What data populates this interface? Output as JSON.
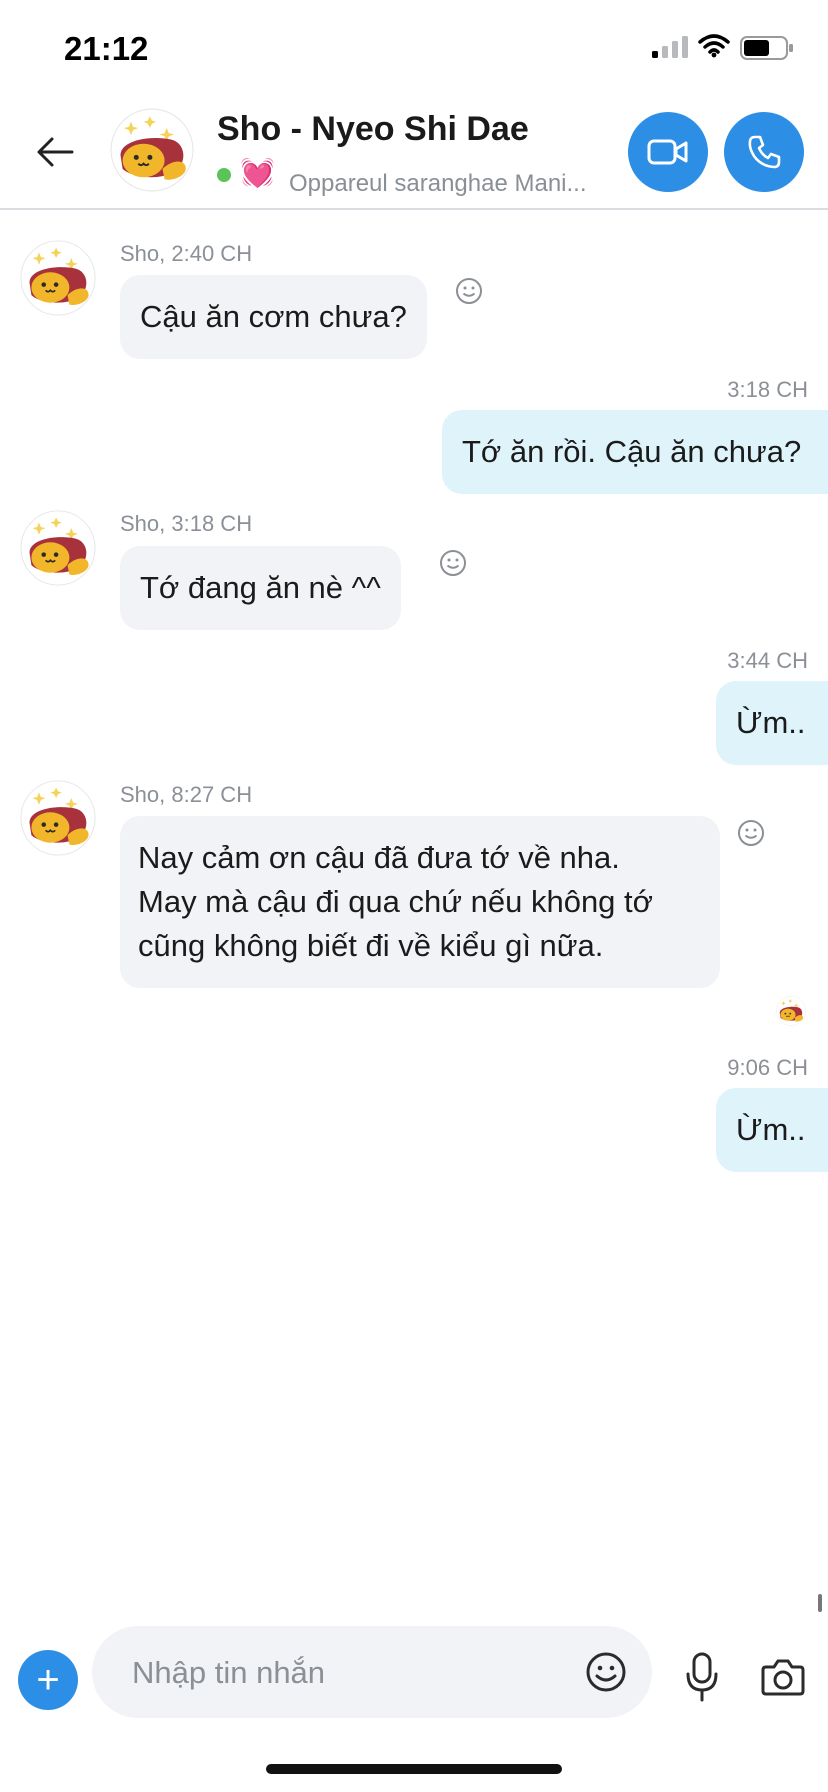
{
  "status_bar": {
    "time": "21:12"
  },
  "header": {
    "contact_name": "Sho - Nyeo Shi Dae",
    "status_text": "Oppareul saranghae Mani...",
    "heart_glyph": "💓",
    "online_color": "#5ac35a",
    "accent_color": "#2d8ee6"
  },
  "messages": [
    {
      "direction": "in",
      "meta": "Sho, 2:40 CH",
      "text": "Cậu ăn cơm chưa?"
    },
    {
      "direction": "out",
      "meta": "3:18 CH",
      "text": "Tớ ăn rồi. Cậu ăn chưa?"
    },
    {
      "direction": "in",
      "meta": "Sho, 3:18 CH",
      "text": "Tớ đang ăn nè ^^"
    },
    {
      "direction": "out",
      "meta": "3:44 CH",
      "text": "Ừm.."
    },
    {
      "direction": "in",
      "meta": "Sho, 8:27 CH",
      "text_lines": [
        "Nay cảm ơn cậu đã đưa tớ về nha.",
        "May mà cậu đi qua chứ nếu không tớ",
        "cũng không biết đi về kiểu gì nữa."
      ]
    },
    {
      "direction": "out",
      "meta": "9:06 CH",
      "text": "Ừm.."
    }
  ],
  "composer": {
    "placeholder": "Nhập tin nhắn",
    "plus_glyph": "+"
  }
}
